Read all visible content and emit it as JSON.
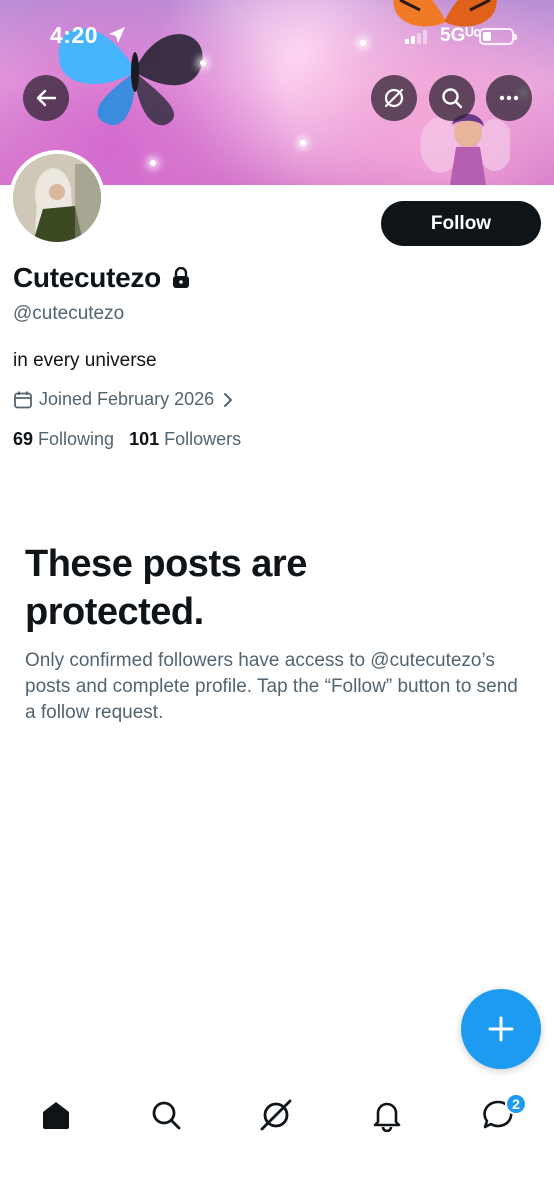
{
  "status_bar": {
    "time": "4:20",
    "network": "5Gᵁᶜ",
    "icons": [
      "location-arrow-icon",
      "signal-icon",
      "battery-icon"
    ]
  },
  "header": {
    "buttons": [
      "back-arrow-icon",
      "grok-icon",
      "search-icon",
      "more-icon"
    ]
  },
  "profile": {
    "follow_label": "Follow",
    "display_name": "Cutecutezo",
    "handle": "@cutecutezo",
    "bio": "in every universe",
    "joined": "Joined February 2026",
    "following_count": "69",
    "following_label": "Following",
    "followers_count": "101",
    "followers_label": "Followers"
  },
  "protected": {
    "title": "These posts are protected.",
    "body": "Only confirmed followers have access to @cutecutezo’s posts and complete profile. Tap the “Follow” button to send a follow request."
  },
  "fab": {
    "icon": "plus-icon"
  },
  "bottom_nav": {
    "items": [
      "home-icon",
      "search-icon",
      "grok-icon",
      "notifications-icon",
      "messages-icon"
    ],
    "messages_badge": "2"
  },
  "colors": {
    "accent": "#1d9bf0",
    "text_primary": "#0f1419",
    "text_secondary": "#536471"
  }
}
